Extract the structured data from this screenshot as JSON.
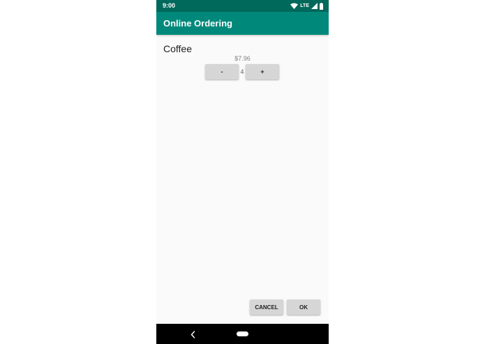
{
  "status_bar": {
    "time": "9:00",
    "network": "LTE",
    "icons": [
      "wifi-icon",
      "signal-icon",
      "battery-icon"
    ]
  },
  "app_bar": {
    "title": "Online Ordering"
  },
  "product": {
    "name": "Coffee",
    "price": "$7.96",
    "quantity": "4",
    "decrement_label": "-",
    "increment_label": "+"
  },
  "dialog_actions": {
    "cancel_label": "CANCEL",
    "ok_label": "OK"
  },
  "nav_bar": {
    "icons": [
      "back-icon",
      "home-icon"
    ]
  },
  "colors": {
    "status_bar": "#00695c",
    "app_bar": "#00897b",
    "background": "#fafafa",
    "button": "#d6d6d6"
  }
}
